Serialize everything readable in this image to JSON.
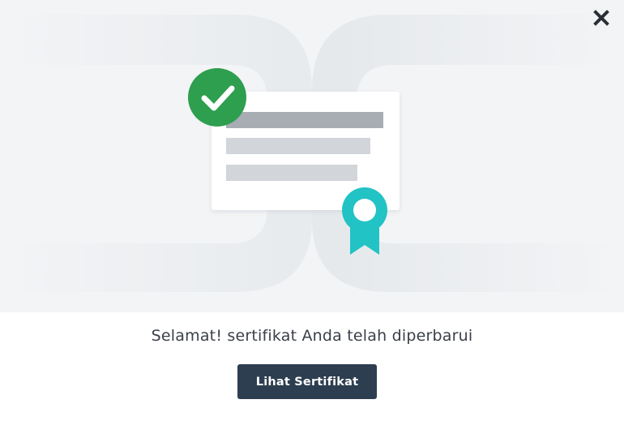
{
  "dialog": {
    "close_icon": "close-icon",
    "illustration": {
      "check_icon": "checkmark-icon",
      "badge_icon": "award-ribbon-icon",
      "colors": {
        "check": "#2e9e4f",
        "badge": "#22c3c5",
        "background": "#f3f4f6"
      }
    },
    "message": "Selamat! sertifikat Anda telah diperbarui",
    "button_label": "Lihat Sertifikat",
    "button_color": "#2d3e50"
  }
}
